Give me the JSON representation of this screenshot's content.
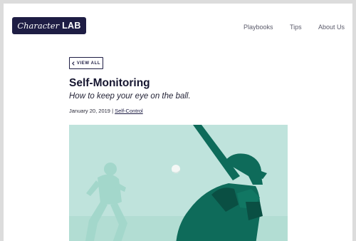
{
  "header": {
    "logo": {
      "script": "Character",
      "bold": "LAB"
    },
    "nav": [
      {
        "label": "Playbooks"
      },
      {
        "label": "Tips"
      },
      {
        "label": "About Us"
      }
    ]
  },
  "article": {
    "back_label": "VIEW ALL",
    "back_icon": "chevron-left-icon",
    "title": "Self-Monitoring",
    "subtitle": "How to keep your eye on the ball.",
    "date": "January 20, 2019",
    "separator": "|",
    "category": "Self-Control"
  },
  "colors": {
    "brand_navy": "#1e1d44",
    "hero_bg": "#bfe3dc",
    "hero_light": "#a3d7cb",
    "hero_dark": "#0e6b5a",
    "hero_darkest": "#0a4f43"
  }
}
